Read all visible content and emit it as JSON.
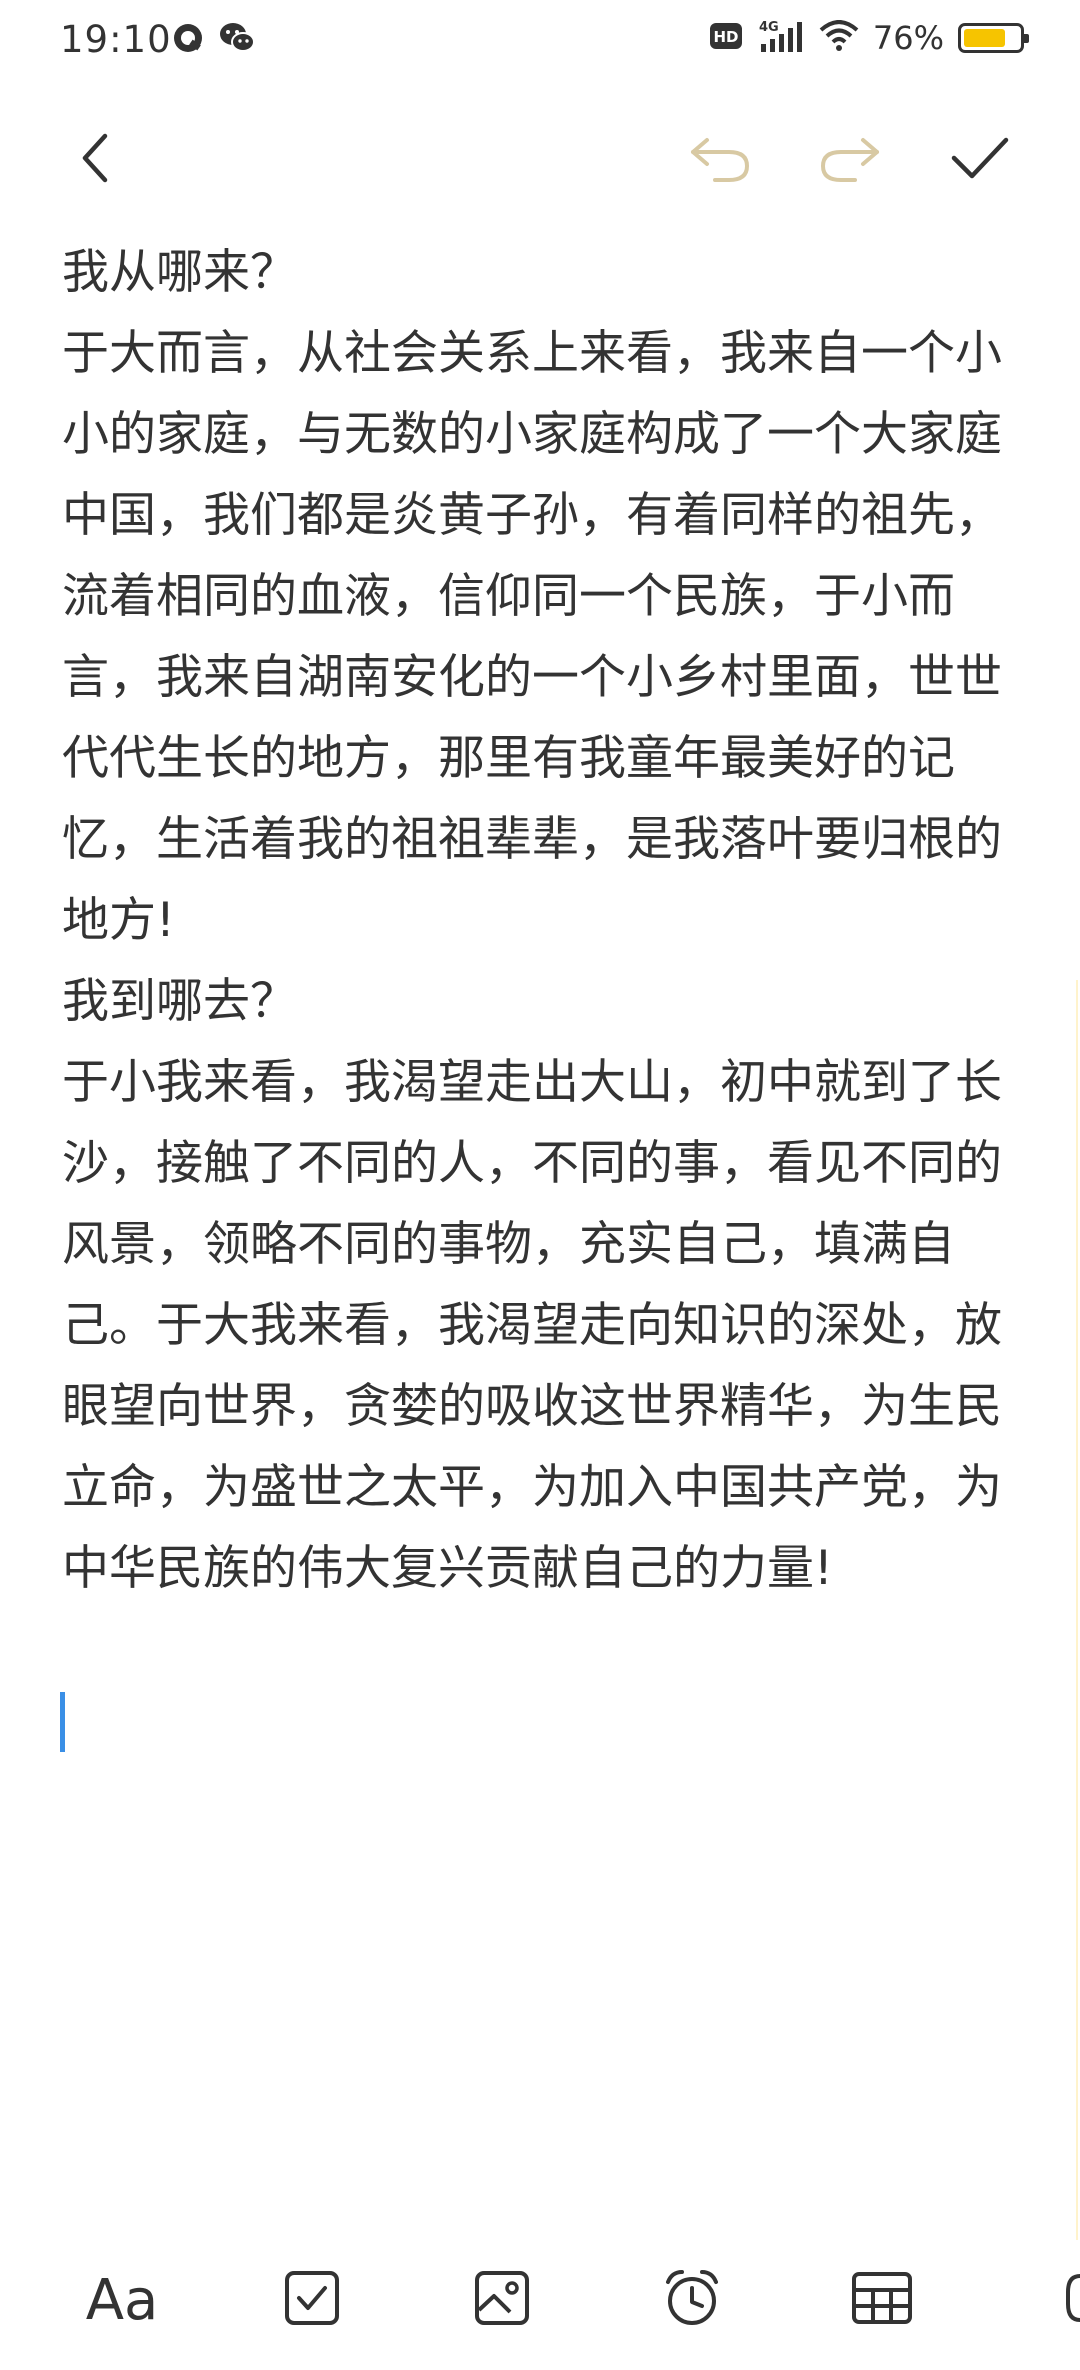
{
  "status_bar": {
    "time": "19:10",
    "network": "4G",
    "battery_percent_text": "76%",
    "battery_level": 0.76,
    "icons": [
      "qq-icon",
      "wechat-icon",
      "hd-icon",
      "signal-icon",
      "wifi-icon",
      "battery-icon"
    ]
  },
  "toolbar": {
    "icons": [
      "back-icon",
      "undo-icon",
      "redo-icon",
      "check-icon"
    ]
  },
  "note": {
    "paragraphs": [
      "我从哪来？",
      "于大而言，从社会关系上来看，我来自一个小小的家庭，与无数的小家庭构成了一个大家庭中国，我们都是炎黄子孙，有着同样的祖先，流着相同的血液，信仰同一个民族，于小而言，我来自湖南安化的一个小乡村里面，世世代代生长的地方，那里有我童年最美好的记忆，生活着我的祖祖辈辈，是我落叶要归根的地方!",
      "我到哪去？",
      "于小我来看，我渴望走出大山，初中就到了长沙，接触了不同的人，不同的事，看见不同的风景，领略不同的事物，充实自己，填满自己。于大我来看，我渴望走向知识的深处，放眼望向世界，贪婪的吸收这世界精华，为生民立命，为盛世之太平，为加入中国共产党，为中华民族的伟大复兴贡献自己的力量!"
    ]
  },
  "bottom_bar": {
    "font_label": "Aa",
    "icons": [
      "font-style-icon",
      "checklist-icon",
      "image-icon",
      "alarm-icon",
      "table-icon",
      "voice-icon"
    ]
  },
  "colors": {
    "text": "#333333",
    "disabled_icon": "#d8c9a3",
    "cursor": "#3a8fe6",
    "battery": "#f6c400"
  }
}
